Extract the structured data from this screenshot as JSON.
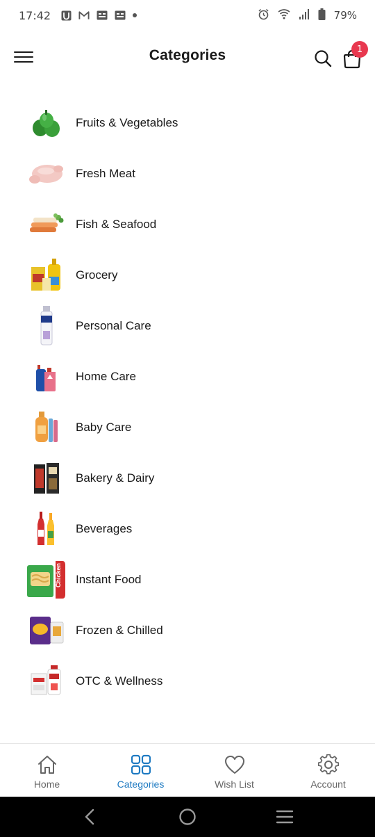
{
  "status_bar": {
    "time": "17:42",
    "battery": "79%",
    "notification_icons": [
      "u-app-icon",
      "gmail-icon",
      "sim-card-icon",
      "sim-card-icon"
    ],
    "system_icons": [
      "alarm-icon",
      "wifi-icon",
      "signal-icon",
      "battery-icon"
    ]
  },
  "header": {
    "title": "Categories",
    "cart_count": "1"
  },
  "categories": [
    {
      "label": "Fruits & Vegetables",
      "icon": "peppers-image"
    },
    {
      "label": "Fresh Meat",
      "icon": "chicken-image"
    },
    {
      "label": "Fish & Seafood",
      "icon": "fish-image"
    },
    {
      "label": "Grocery",
      "icon": "grocery-image"
    },
    {
      "label": "Personal Care",
      "icon": "spray-can-image"
    },
    {
      "label": "Home Care",
      "icon": "cleaner-bottles-image"
    },
    {
      "label": "Baby Care",
      "icon": "baby-products-image"
    },
    {
      "label": "Bakery & Dairy",
      "icon": "bakery-dairy-image"
    },
    {
      "label": "Beverages",
      "icon": "beverage-bottles-image"
    },
    {
      "label": "Instant Food",
      "icon": "noodle-packs-image"
    },
    {
      "label": "Frozen & Chilled",
      "icon": "frozen-snacks-image"
    },
    {
      "label": "OTC & Wellness",
      "icon": "wellness-products-image"
    }
  ],
  "bottom_nav": {
    "items": [
      {
        "label": "Home",
        "icon": "home-icon"
      },
      {
        "label": "Categories",
        "icon": "grid-icon"
      },
      {
        "label": "Wish List",
        "icon": "heart-icon"
      },
      {
        "label": "Account",
        "icon": "gear-icon"
      }
    ],
    "active_index": 1
  },
  "colors": {
    "accent": "#1e7ac2",
    "badge": "#e8384f"
  }
}
